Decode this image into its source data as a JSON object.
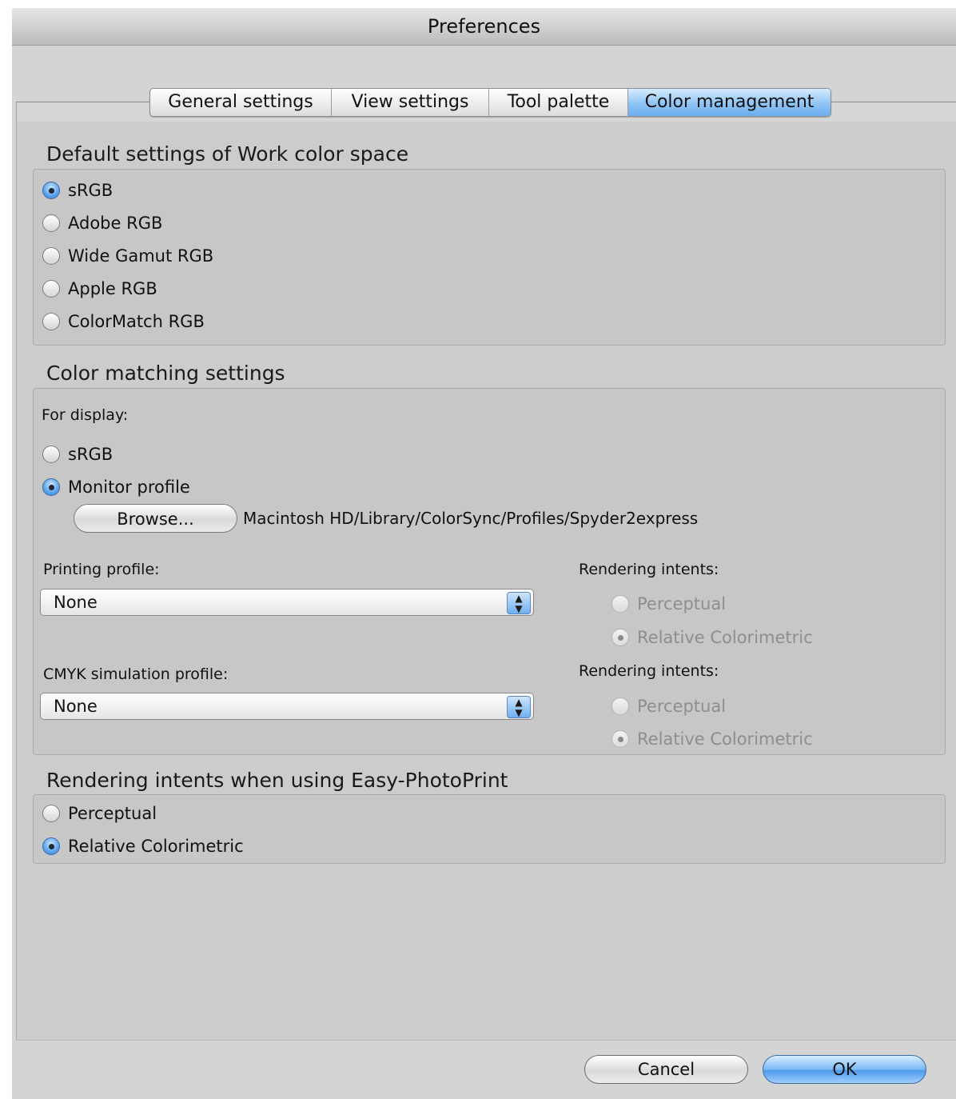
{
  "window": {
    "title": "Preferences"
  },
  "tabs": [
    {
      "label": "General settings"
    },
    {
      "label": "View settings"
    },
    {
      "label": "Tool palette"
    },
    {
      "label": "Color management",
      "active": true
    }
  ],
  "work_color_space": {
    "title": "Default settings of Work color space",
    "options": [
      {
        "label": "sRGB",
        "checked": true
      },
      {
        "label": "Adobe RGB",
        "checked": false
      },
      {
        "label": "Wide Gamut RGB",
        "checked": false
      },
      {
        "label": "Apple RGB",
        "checked": false
      },
      {
        "label": "ColorMatch RGB",
        "checked": false
      }
    ]
  },
  "color_matching": {
    "title": "Color matching settings",
    "for_display_label": "For display:",
    "display_options": [
      {
        "label": "sRGB",
        "checked": false
      },
      {
        "label": "Monitor profile",
        "checked": true
      }
    ],
    "browse_label": "Browse...",
    "monitor_profile_path": "Macintosh HD/Library/ColorSync/Profiles/Spyder2express",
    "printing_profile_label": "Printing profile:",
    "printing_profile_value": "None",
    "cmyk_profile_label": "CMYK simulation profile:",
    "cmyk_profile_value": "None",
    "rendering_intents_label": "Rendering intents:",
    "printing_intents": [
      {
        "label": "Perceptual",
        "checked": false
      },
      {
        "label": "Relative Colorimetric",
        "checked": true
      }
    ],
    "cmyk_intents": [
      {
        "label": "Perceptual",
        "checked": false
      },
      {
        "label": "Relative Colorimetric",
        "checked": true
      }
    ]
  },
  "easy_photoprint": {
    "title": "Rendering intents when using Easy-PhotoPrint",
    "options": [
      {
        "label": "Perceptual",
        "checked": false
      },
      {
        "label": "Relative Colorimetric",
        "checked": true
      }
    ]
  },
  "buttons": {
    "cancel": "Cancel",
    "ok": "OK"
  },
  "colors": {
    "accent": "#6baef0",
    "window_bg": "#d4d4d4"
  }
}
